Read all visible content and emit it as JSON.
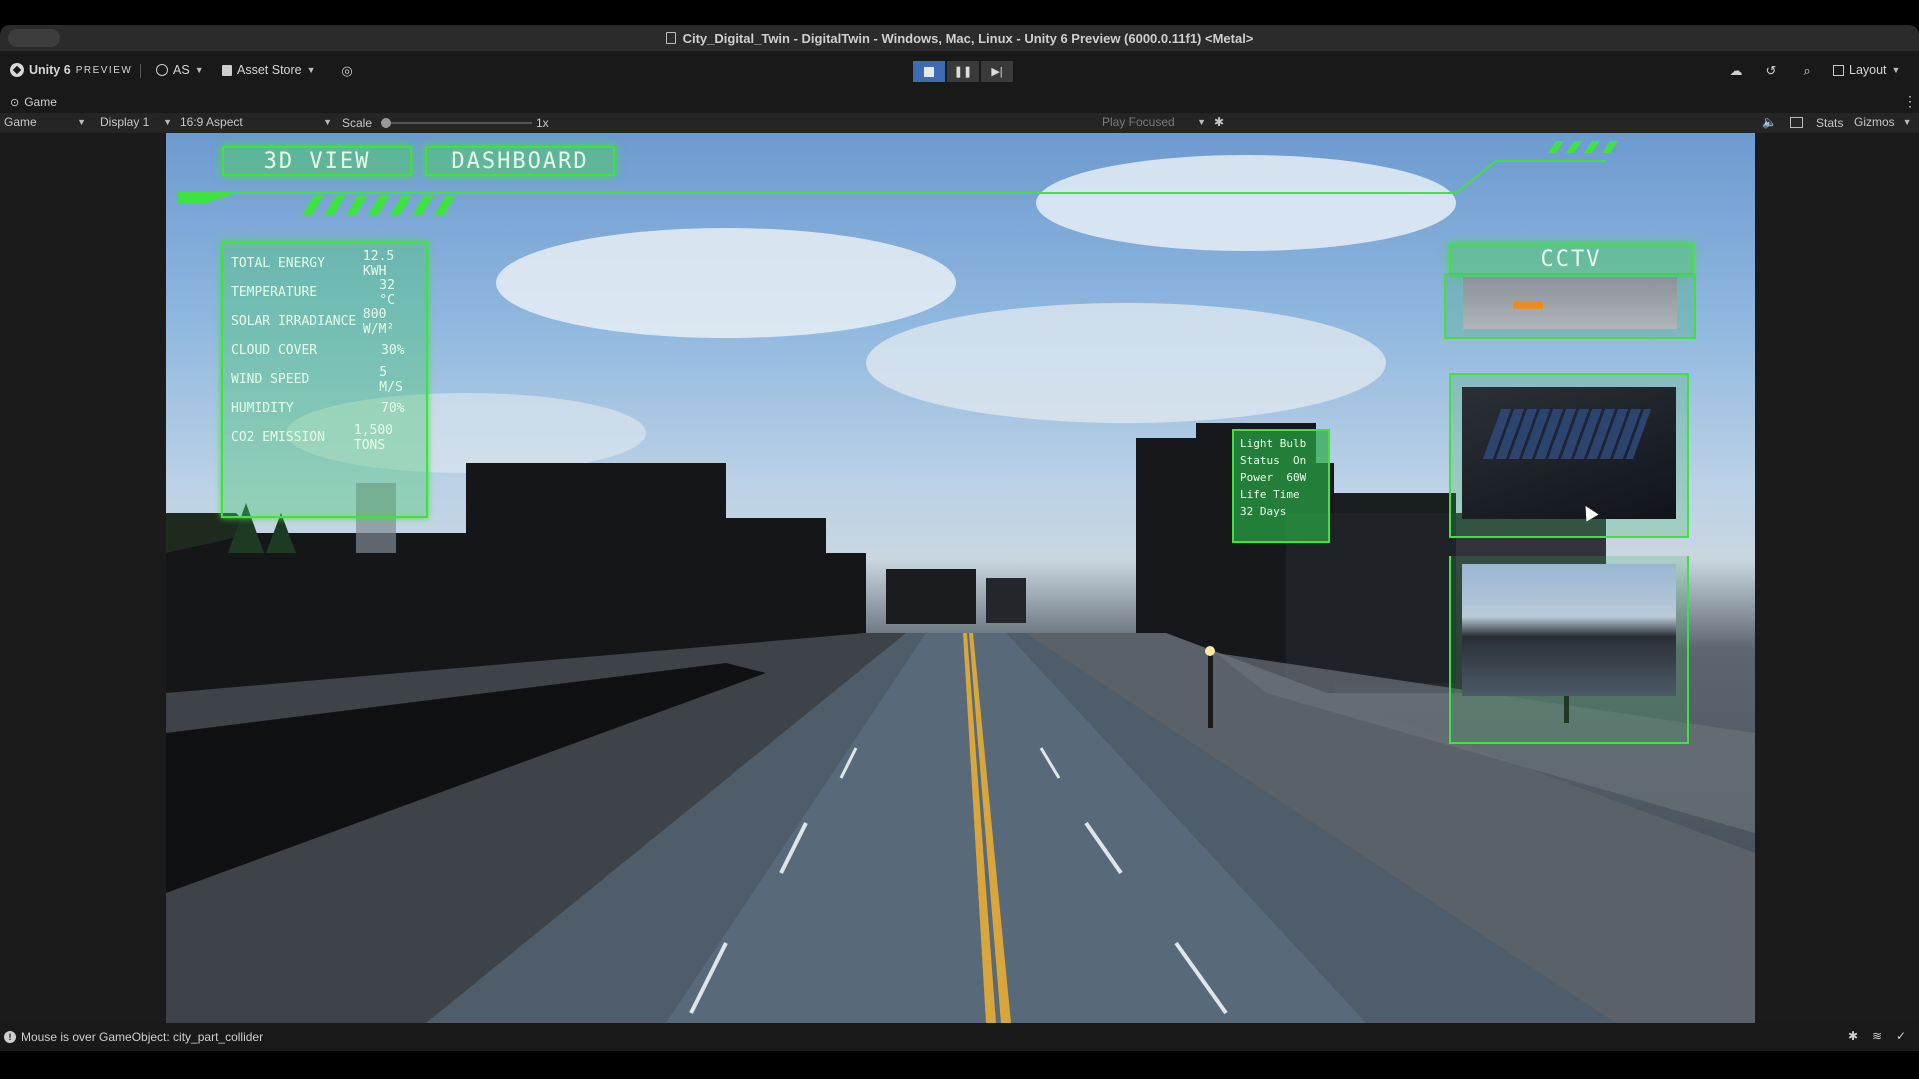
{
  "window": {
    "title": "City_Digital_Twin - DigitalTwin - Windows, Mac, Linux - Unity 6 Preview (6000.0.11f1) <Metal>"
  },
  "toolbar": {
    "brand": "Unity 6",
    "brand_suffix": "PREVIEW",
    "account": "AS",
    "asset_store": "Asset Store",
    "layout": "Layout"
  },
  "game_tab": {
    "label": "Game"
  },
  "game_controls": {
    "view": "Game",
    "display": "Display 1",
    "aspect": "16:9 Aspect",
    "scale_label": "Scale",
    "scale_value": "1x",
    "play_focused": "Play Focused",
    "stats": "Stats",
    "gizmos": "Gizmos"
  },
  "hud": {
    "tabs": [
      "3D VIEW",
      "DASHBOARD"
    ],
    "stats": [
      {
        "label": "TOTAL ENERGY",
        "value": "12.5 KWH"
      },
      {
        "label": "TEMPERATURE",
        "value": "32 °C"
      },
      {
        "label": "SOLAR IRRADIANCE",
        "value": "800 W/M²"
      },
      {
        "label": "CLOUD COVER",
        "value": "30%"
      },
      {
        "label": "WIND SPEED",
        "value": "5 M/S"
      },
      {
        "label": "HUMIDITY",
        "value": "70%"
      },
      {
        "label": "CO2 EMISSION",
        "value": "1,500 TONS"
      }
    ],
    "cctv_title": "CCTV",
    "light_bulb": {
      "title": "Light Bulb",
      "status_label": "Status",
      "status_value": "On",
      "power_label": "Power",
      "power_value": "60W",
      "lifetime_label": "Life Time",
      "lifetime_value": "32 Days"
    }
  },
  "status": {
    "message": "Mouse is over GameObject: city_part_collider"
  },
  "colors": {
    "hud_green": "#3fe23f",
    "play_active": "#3d6bb5"
  }
}
